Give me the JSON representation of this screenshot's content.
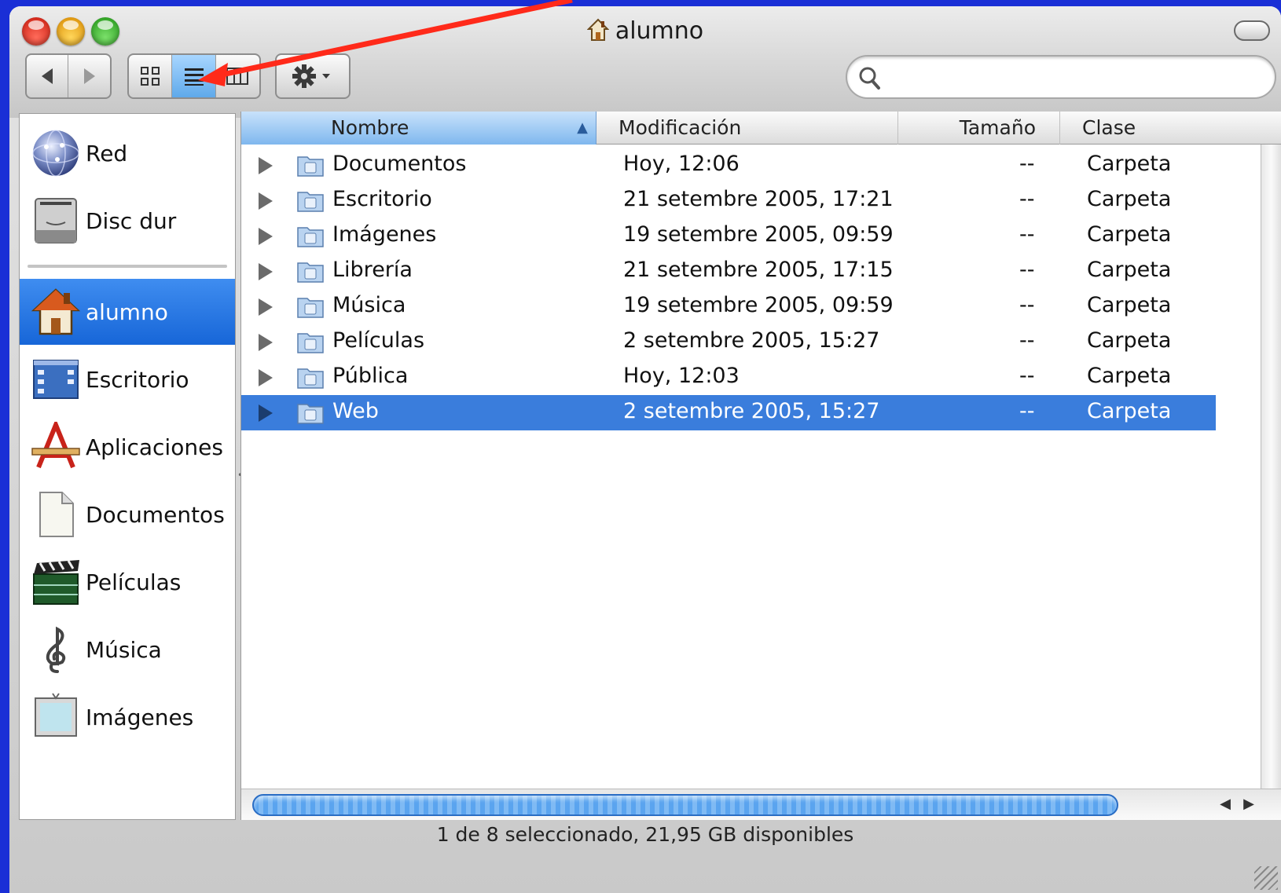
{
  "window": {
    "title": "alumno"
  },
  "colors": {
    "accent": "#3a7ddc",
    "annotation": "#ff2a1a",
    "background": "#1a2fd6"
  },
  "toolbar": {
    "nav": [
      {
        "icon": "back-arrow-icon"
      },
      {
        "icon": "forward-arrow-icon"
      }
    ],
    "views": [
      {
        "icon": "icon-view-icon"
      },
      {
        "icon": "list-view-icon",
        "active": true
      },
      {
        "icon": "column-view-icon"
      }
    ],
    "action": {
      "icon": "gear-icon"
    },
    "search": {
      "value": "",
      "placeholder": ""
    }
  },
  "sidebar": {
    "devices": [
      {
        "label": "Red",
        "icon": "network-globe-icon"
      },
      {
        "label": "Disc dur",
        "icon": "hard-disk-icon"
      }
    ],
    "places": [
      {
        "label": "alumno",
        "icon": "home-icon",
        "selected": true
      },
      {
        "label": "Escritorio",
        "icon": "desktop-icon"
      },
      {
        "label": "Aplicaciones",
        "icon": "applications-icon"
      },
      {
        "label": "Documentos",
        "icon": "document-icon"
      },
      {
        "label": "Películas",
        "icon": "clapperboard-icon"
      },
      {
        "label": "Música",
        "icon": "treble-clef-icon"
      },
      {
        "label": "Imágenes",
        "icon": "picture-frame-icon"
      }
    ]
  },
  "list": {
    "columns": {
      "name": "Nombre",
      "modified": "Modificación",
      "size": "Tamaño",
      "kind": "Clase"
    },
    "rows": [
      {
        "name": "Documentos",
        "modified": "Hoy, 12:06",
        "size": "--",
        "kind": "Carpeta",
        "icon": "folder-icon"
      },
      {
        "name": "Escritorio",
        "modified": "21 setembre 2005, 17:21",
        "size": "--",
        "kind": "Carpeta",
        "icon": "desktop-folder-icon"
      },
      {
        "name": "Imágenes",
        "modified": "19 setembre 2005, 09:59",
        "size": "--",
        "kind": "Carpeta",
        "icon": "pictures-folder-icon"
      },
      {
        "name": "Librería",
        "modified": "21 setembre 2005, 17:15",
        "size": "--",
        "kind": "Carpeta",
        "icon": "library-folder-icon"
      },
      {
        "name": "Música",
        "modified": "19 setembre 2005, 09:59",
        "size": "--",
        "kind": "Carpeta",
        "icon": "music-folder-icon"
      },
      {
        "name": "Películas",
        "modified": "2 setembre 2005, 15:27",
        "size": "--",
        "kind": "Carpeta",
        "icon": "movies-folder-icon"
      },
      {
        "name": "Pública",
        "modified": "Hoy, 12:03",
        "size": "--",
        "kind": "Carpeta",
        "icon": "public-folder-icon"
      },
      {
        "name": "Web",
        "modified": "2 setembre 2005, 15:27",
        "size": "--",
        "kind": "Carpeta",
        "icon": "sites-folder-icon",
        "selected": true
      }
    ]
  },
  "status": {
    "text": "1 de 8 seleccionado, 21,95 GB disponibles"
  }
}
